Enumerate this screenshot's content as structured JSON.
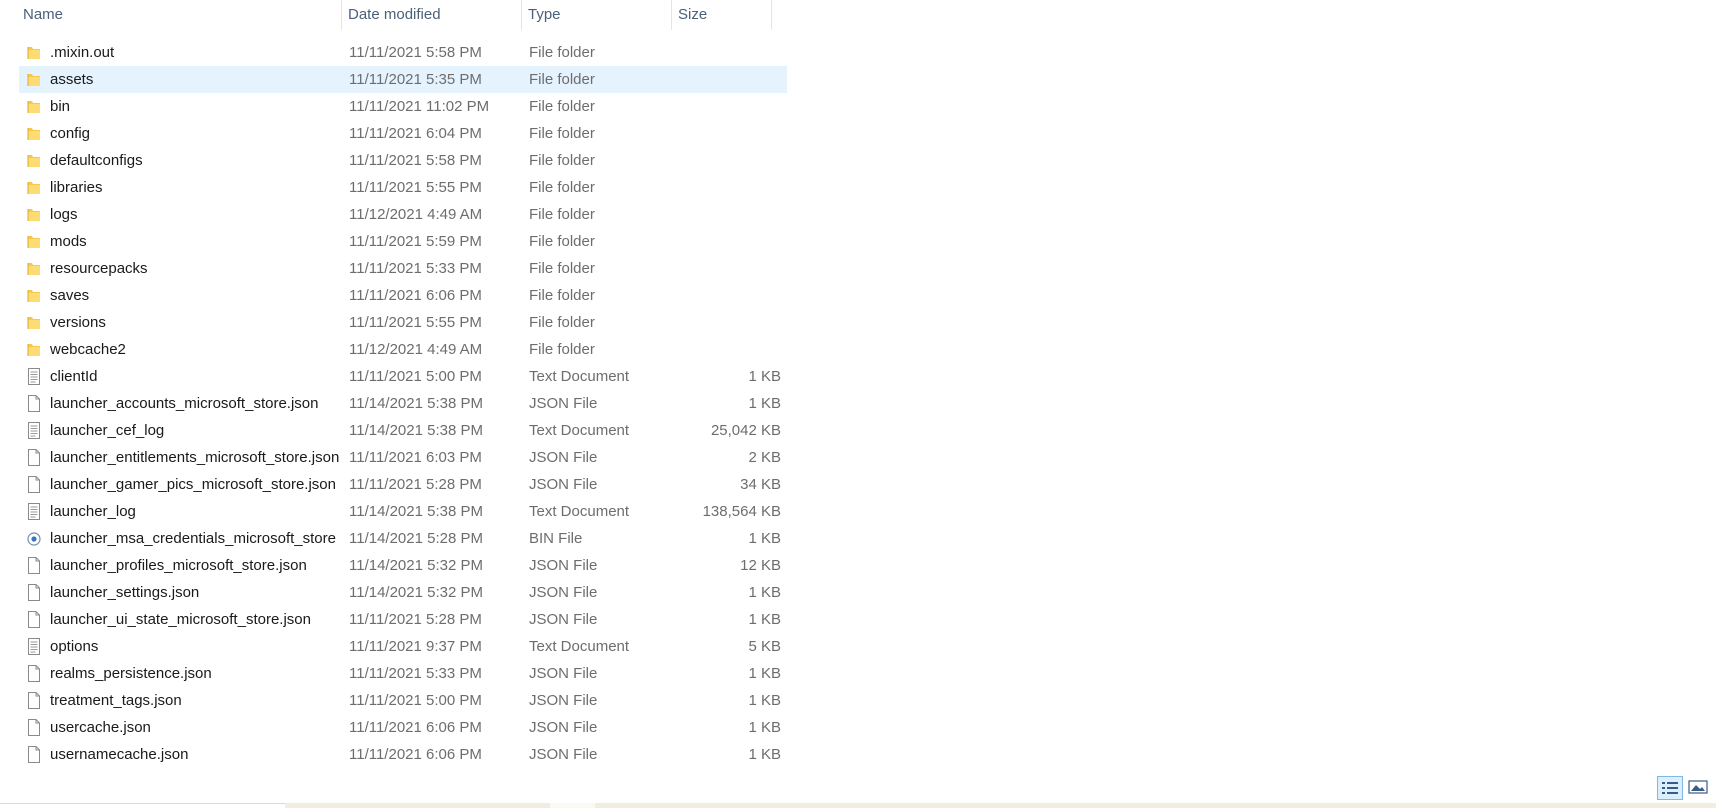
{
  "columns": {
    "name": "Name",
    "date": "Date modified",
    "type": "Type",
    "size": "Size"
  },
  "files": [
    {
      "name": ".mixin.out",
      "date": "11/11/2021 5:58 PM",
      "type": "File folder",
      "size": "",
      "icon": "folder-icon"
    },
    {
      "name": "assets",
      "date": "11/11/2021 5:35 PM",
      "type": "File folder",
      "size": "",
      "icon": "folder-icon",
      "selected": true
    },
    {
      "name": "bin",
      "date": "11/11/2021 11:02 PM",
      "type": "File folder",
      "size": "",
      "icon": "folder-icon"
    },
    {
      "name": "config",
      "date": "11/11/2021 6:04 PM",
      "type": "File folder",
      "size": "",
      "icon": "folder-icon"
    },
    {
      "name": "defaultconfigs",
      "date": "11/11/2021 5:58 PM",
      "type": "File folder",
      "size": "",
      "icon": "folder-icon"
    },
    {
      "name": "libraries",
      "date": "11/11/2021 5:55 PM",
      "type": "File folder",
      "size": "",
      "icon": "folder-icon"
    },
    {
      "name": "logs",
      "date": "11/12/2021 4:49 AM",
      "type": "File folder",
      "size": "",
      "icon": "folder-icon"
    },
    {
      "name": "mods",
      "date": "11/11/2021 5:59 PM",
      "type": "File folder",
      "size": "",
      "icon": "folder-icon"
    },
    {
      "name": "resourcepacks",
      "date": "11/11/2021 5:33 PM",
      "type": "File folder",
      "size": "",
      "icon": "folder-icon"
    },
    {
      "name": "saves",
      "date": "11/11/2021 6:06 PM",
      "type": "File folder",
      "size": "",
      "icon": "folder-icon"
    },
    {
      "name": "versions",
      "date": "11/11/2021 5:55 PM",
      "type": "File folder",
      "size": "",
      "icon": "folder-icon"
    },
    {
      "name": "webcache2",
      "date": "11/12/2021 4:49 AM",
      "type": "File folder",
      "size": "",
      "icon": "folder-icon"
    },
    {
      "name": "clientId",
      "date": "11/11/2021 5:00 PM",
      "type": "Text Document",
      "size": "1 KB",
      "icon": "text-document-icon"
    },
    {
      "name": "launcher_accounts_microsoft_store.json",
      "date": "11/14/2021 5:38 PM",
      "type": "JSON File",
      "size": "1 KB",
      "icon": "file-icon"
    },
    {
      "name": "launcher_cef_log",
      "date": "11/14/2021 5:38 PM",
      "type": "Text Document",
      "size": "25,042 KB",
      "icon": "text-document-icon"
    },
    {
      "name": "launcher_entitlements_microsoft_store.json",
      "date": "11/11/2021 6:03 PM",
      "type": "JSON File",
      "size": "2 KB",
      "icon": "file-icon"
    },
    {
      "name": "launcher_gamer_pics_microsoft_store.json",
      "date": "11/11/2021 5:28 PM",
      "type": "JSON File",
      "size": "34 KB",
      "icon": "file-icon"
    },
    {
      "name": "launcher_log",
      "date": "11/14/2021 5:38 PM",
      "type": "Text Document",
      "size": "138,564 KB",
      "icon": "text-document-icon"
    },
    {
      "name": "launcher_msa_credentials_microsoft_store",
      "date": "11/14/2021 5:28 PM",
      "type": "BIN File",
      "size": "1 KB",
      "icon": "bin-file-icon"
    },
    {
      "name": "launcher_profiles_microsoft_store.json",
      "date": "11/14/2021 5:32 PM",
      "type": "JSON File",
      "size": "12 KB",
      "icon": "file-icon"
    },
    {
      "name": "launcher_settings.json",
      "date": "11/14/2021 5:32 PM",
      "type": "JSON File",
      "size": "1 KB",
      "icon": "file-icon"
    },
    {
      "name": "launcher_ui_state_microsoft_store.json",
      "date": "11/11/2021 5:28 PM",
      "type": "JSON File",
      "size": "1 KB",
      "icon": "file-icon"
    },
    {
      "name": "options",
      "date": "11/11/2021 9:37 PM",
      "type": "Text Document",
      "size": "5 KB",
      "icon": "text-document-icon"
    },
    {
      "name": "realms_persistence.json",
      "date": "11/11/2021 5:33 PM",
      "type": "JSON File",
      "size": "1 KB",
      "icon": "file-icon"
    },
    {
      "name": "treatment_tags.json",
      "date": "11/11/2021 5:00 PM",
      "type": "JSON File",
      "size": "1 KB",
      "icon": "file-icon"
    },
    {
      "name": "usercache.json",
      "date": "11/11/2021 6:06 PM",
      "type": "JSON File",
      "size": "1 KB",
      "icon": "file-icon"
    },
    {
      "name": "usernamecache.json",
      "date": "11/11/2021 6:06 PM",
      "type": "JSON File",
      "size": "1 KB",
      "icon": "file-icon"
    }
  ],
  "view_buttons": {
    "details_icon": "details-view-icon",
    "tiles_icon": "large-icons-view-icon",
    "active": "details"
  },
  "colors": {
    "selection": "#e5f3ff",
    "header_text": "#4c607a",
    "folder": "#f6c94d"
  }
}
